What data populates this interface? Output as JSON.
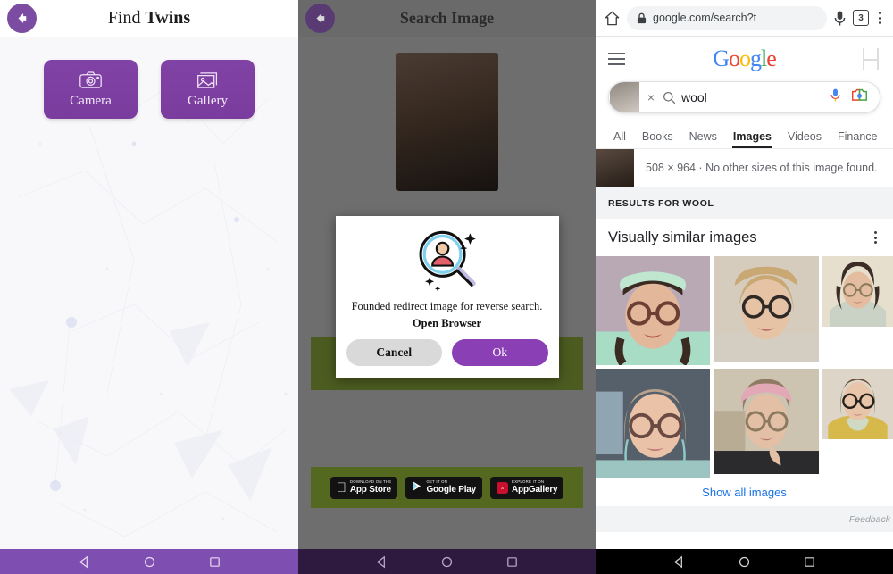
{
  "app_twins": {
    "title_light": "Find ",
    "title_bold": "Twins",
    "back_icon": "back-arrow-icon",
    "buttons": [
      {
        "label": "Camera",
        "icon": "camera-icon"
      },
      {
        "label": "Gallery",
        "icon": "gallery-icon"
      }
    ],
    "navbar": {
      "back": "triangle-back-icon",
      "home": "circle-home-icon",
      "recents": "square-recents-icon"
    }
  },
  "app_search": {
    "title": "Search Image",
    "back_icon": "back-arrow-icon",
    "dialog": {
      "icon": "magnifier-person-icon",
      "message": "Founded redirect image for reverse search.",
      "emphasis": "Open Browser",
      "cancel_label": "Cancel",
      "ok_label": "Ok"
    },
    "store_badges": [
      {
        "small": "Download on the",
        "big": "App Store",
        "glyph": "apple-icon"
      },
      {
        "small": "GET IT ON",
        "big": "Google Play",
        "glyph": "play-icon"
      },
      {
        "small": "EXPLORE IT ON",
        "big": "AppGallery",
        "glyph": "appgallery-icon"
      }
    ]
  },
  "browser": {
    "chrome": {
      "home_icon": "home-icon",
      "lock_icon": "lock-icon",
      "url": "google.com/search?t",
      "mic_icon": "microphone-icon",
      "tab_count": "3",
      "menu_icon": "kebab-menu-icon"
    },
    "google": {
      "menu_icon": "hamburger-menu-icon",
      "logo": [
        {
          "ch": "G",
          "c": "b"
        },
        {
          "ch": "o",
          "c": "r"
        },
        {
          "ch": "o",
          "c": "y"
        },
        {
          "ch": "g",
          "c": "b"
        },
        {
          "ch": "l",
          "c": "g"
        },
        {
          "ch": "e",
          "c": "r"
        }
      ],
      "account_icon": "account-placeholder-icon",
      "search": {
        "thumb_icon": "image-thumbnail",
        "clear_label": "×",
        "search_icon": "search-icon",
        "query": "wool",
        "voice_icon": "microphone-icon",
        "lens_icon": "google-lens-camera-icon"
      },
      "tabs": [
        {
          "label": "All",
          "active": false
        },
        {
          "label": "Books",
          "active": false
        },
        {
          "label": "News",
          "active": false
        },
        {
          "label": "Images",
          "active": true
        },
        {
          "label": "Videos",
          "active": false
        },
        {
          "label": "Finance",
          "active": false
        }
      ],
      "size_info": "508 × 964 · No other sizes of this image found.",
      "results_for": "RESULTS FOR WOOL",
      "section_title": "Visually similar images",
      "section_menu_icon": "kebab-menu-icon",
      "images": [
        {
          "alt": "woman-with-mint-knit-hat-and-glasses",
          "bg": "#b9a9b5",
          "skin": "#e2b79a",
          "hair": "#3a2a22",
          "hat": "#bfe6cf",
          "shirt": "#a9dcc5",
          "glasses": "#6b3f33"
        },
        {
          "alt": "blonde-woman-with-round-glasses",
          "bg": "#d6ccbd",
          "skin": "#e7c3a6",
          "hair": "#c9a874",
          "hat": "",
          "shirt": "#d4cec2",
          "glasses": "#2f2a26"
        },
        {
          "alt": "woman-in-grey-hoodie-with-glasses",
          "bg": "#e6dfcd",
          "skin": "#e4bda0",
          "hair": "#3c2c26",
          "hat": "",
          "shirt": "#c9d2c4",
          "glasses": "#8a7a5c"
        },
        {
          "alt": "woman-in-car-with-teal-ombre-hair",
          "bg": "#55606a",
          "skin": "#e9c2a8",
          "hair": "#b9a28c",
          "hat": "",
          "shirt": "#9cc4c0",
          "glasses": "#6a4a42"
        },
        {
          "alt": "woman-with-pink-beanie-and-glasses",
          "bg": "#cdc3b1",
          "skin": "#e3c0a5",
          "hair": "#8f7a64",
          "hat": "#e3a8b6",
          "shirt": "#2b2b2e",
          "glasses": "#8c7a60"
        },
        {
          "alt": "woman-in-yellow-cardigan-with-scarf",
          "bg": "#ddd6c8",
          "skin": "#e8c4a8",
          "hair": "#6a4b35",
          "hat": "",
          "shirt": "#d7b84a",
          "glasses": "#23201c"
        }
      ],
      "show_all_label": "Show all images",
      "feedback_label": "Feedback"
    },
    "navbar": {
      "back": "triangle-back-icon",
      "home": "circle-home-icon",
      "recents": "square-recents-icon"
    }
  },
  "colors": {
    "brand_purple": "#7e3fa0",
    "navbar_light": "#7e4fb0",
    "navbar_dark": "#2e1a3e",
    "dialog_ok": "#8a3fb5",
    "green_banner": "#55681f",
    "link_blue": "#1a73e8"
  }
}
